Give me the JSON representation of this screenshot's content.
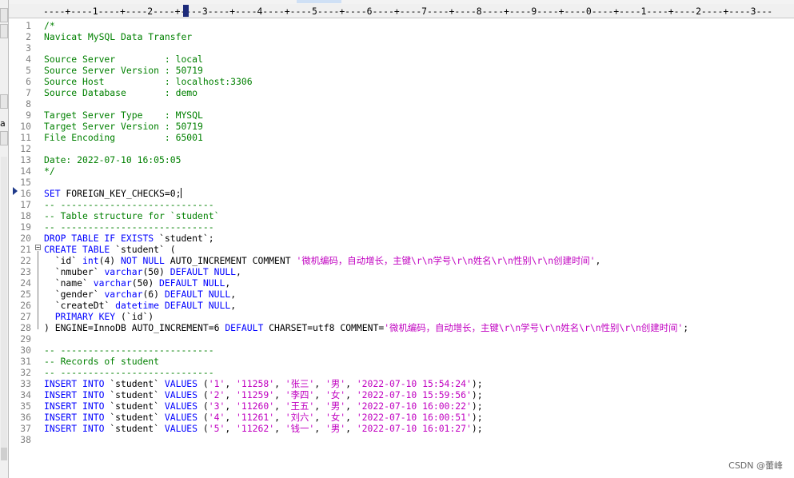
{
  "colors": {
    "keyword": "#0000ff",
    "comment": "#008000",
    "string": "#c000c0",
    "text": "#000000",
    "line_number": "#808080"
  },
  "ruler": {
    "text": "----+----1----+----2----+----3----+----4----+----5----+----6----+----7----+----8----+----9----+----0----+----1----+----2----+----3---"
  },
  "left_panel": {
    "sliver_text": "a"
  },
  "editor": {
    "caret_line": 16,
    "lines": [
      {
        "n": "1",
        "tokens": [
          {
            "t": "/*",
            "c": "comment"
          }
        ]
      },
      {
        "n": "2",
        "tokens": [
          {
            "t": "Navicat MySQL Data Transfer",
            "c": "comment"
          }
        ]
      },
      {
        "n": "3",
        "tokens": []
      },
      {
        "n": "4",
        "tokens": [
          {
            "t": "Source Server         : local",
            "c": "comment"
          }
        ]
      },
      {
        "n": "5",
        "tokens": [
          {
            "t": "Source Server Version : 50719",
            "c": "comment"
          }
        ]
      },
      {
        "n": "6",
        "tokens": [
          {
            "t": "Source Host           : localhost:3306",
            "c": "comment"
          }
        ]
      },
      {
        "n": "7",
        "tokens": [
          {
            "t": "Source Database       : demo",
            "c": "comment"
          }
        ]
      },
      {
        "n": "8",
        "tokens": []
      },
      {
        "n": "9",
        "tokens": [
          {
            "t": "Target Server Type    : MYSQL",
            "c": "comment"
          }
        ]
      },
      {
        "n": "10",
        "tokens": [
          {
            "t": "Target Server Version : 50719",
            "c": "comment"
          }
        ]
      },
      {
        "n": "11",
        "tokens": [
          {
            "t": "File Encoding         : 65001",
            "c": "comment"
          }
        ]
      },
      {
        "n": "12",
        "tokens": []
      },
      {
        "n": "13",
        "tokens": [
          {
            "t": "Date: 2022-07-10 16:05:05",
            "c": "comment"
          }
        ]
      },
      {
        "n": "14",
        "tokens": [
          {
            "t": "*/",
            "c": "comment"
          }
        ]
      },
      {
        "n": "15",
        "tokens": []
      },
      {
        "n": "16",
        "tokens": [
          {
            "t": "SET",
            "c": "keyword"
          },
          {
            "t": " FOREIGN_KEY_CHECKS=0;",
            "c": "text"
          }
        ]
      },
      {
        "n": "17",
        "tokens": [
          {
            "t": "-- ----------------------------",
            "c": "comment"
          }
        ]
      },
      {
        "n": "18",
        "tokens": [
          {
            "t": "-- Table structure for `student`",
            "c": "comment"
          }
        ]
      },
      {
        "n": "19",
        "tokens": [
          {
            "t": "-- ----------------------------",
            "c": "comment"
          }
        ]
      },
      {
        "n": "20",
        "tokens": [
          {
            "t": "DROP TABLE IF EXISTS",
            "c": "keyword"
          },
          {
            "t": " `student`;",
            "c": "text"
          }
        ]
      },
      {
        "n": "21",
        "tokens": [
          {
            "t": "CREATE TABLE",
            "c": "keyword"
          },
          {
            "t": " `student` (",
            "c": "text"
          }
        ]
      },
      {
        "n": "22",
        "tokens": [
          {
            "t": "  `id` ",
            "c": "text"
          },
          {
            "t": "int",
            "c": "keyword"
          },
          {
            "t": "(4) ",
            "c": "text"
          },
          {
            "t": "NOT NULL",
            "c": "keyword"
          },
          {
            "t": " AUTO_INCREMENT COMMENT ",
            "c": "text"
          },
          {
            "t": "'微机编码，自动增长，主键\\r\\n学号\\r\\n姓名\\r\\n性别\\r\\n创建时间'",
            "c": "string"
          },
          {
            "t": ",",
            "c": "text"
          }
        ]
      },
      {
        "n": "23",
        "tokens": [
          {
            "t": "  `nmuber` ",
            "c": "text"
          },
          {
            "t": "varchar",
            "c": "keyword"
          },
          {
            "t": "(50) ",
            "c": "text"
          },
          {
            "t": "DEFAULT NULL",
            "c": "keyword"
          },
          {
            "t": ",",
            "c": "text"
          }
        ]
      },
      {
        "n": "24",
        "tokens": [
          {
            "t": "  `name` ",
            "c": "text"
          },
          {
            "t": "varchar",
            "c": "keyword"
          },
          {
            "t": "(50) ",
            "c": "text"
          },
          {
            "t": "DEFAULT NULL",
            "c": "keyword"
          },
          {
            "t": ",",
            "c": "text"
          }
        ]
      },
      {
        "n": "25",
        "tokens": [
          {
            "t": "  `gender` ",
            "c": "text"
          },
          {
            "t": "varchar",
            "c": "keyword"
          },
          {
            "t": "(6) ",
            "c": "text"
          },
          {
            "t": "DEFAULT NULL",
            "c": "keyword"
          },
          {
            "t": ",",
            "c": "text"
          }
        ]
      },
      {
        "n": "26",
        "tokens": [
          {
            "t": "  `createDt` ",
            "c": "text"
          },
          {
            "t": "datetime",
            "c": "keyword"
          },
          {
            "t": " ",
            "c": "text"
          },
          {
            "t": "DEFAULT NULL",
            "c": "keyword"
          },
          {
            "t": ",",
            "c": "text"
          }
        ]
      },
      {
        "n": "27",
        "tokens": [
          {
            "t": "  ",
            "c": "text"
          },
          {
            "t": "PRIMARY KEY",
            "c": "keyword"
          },
          {
            "t": " (`id`)",
            "c": "text"
          }
        ]
      },
      {
        "n": "28",
        "tokens": [
          {
            "t": ") ENGINE=InnoDB AUTO_INCREMENT=6 ",
            "c": "text"
          },
          {
            "t": "DEFAULT",
            "c": "keyword"
          },
          {
            "t": " CHARSET=utf8 COMMENT=",
            "c": "text"
          },
          {
            "t": "'微机编码，自动增长，主键\\r\\n学号\\r\\n姓名\\r\\n性别\\r\\n创建时间'",
            "c": "string"
          },
          {
            "t": ";",
            "c": "text"
          }
        ]
      },
      {
        "n": "29",
        "tokens": []
      },
      {
        "n": "30",
        "tokens": [
          {
            "t": "-- ----------------------------",
            "c": "comment"
          }
        ]
      },
      {
        "n": "31",
        "tokens": [
          {
            "t": "-- Records of student",
            "c": "comment"
          }
        ]
      },
      {
        "n": "32",
        "tokens": [
          {
            "t": "-- ----------------------------",
            "c": "comment"
          }
        ]
      },
      {
        "n": "33",
        "tokens": [
          {
            "t": "INSERT INTO",
            "c": "keyword"
          },
          {
            "t": " `student` ",
            "c": "text"
          },
          {
            "t": "VALUES",
            "c": "keyword"
          },
          {
            "t": " (",
            "c": "text"
          },
          {
            "t": "'1'",
            "c": "string"
          },
          {
            "t": ", ",
            "c": "text"
          },
          {
            "t": "'11258'",
            "c": "string"
          },
          {
            "t": ", ",
            "c": "text"
          },
          {
            "t": "'张三'",
            "c": "string"
          },
          {
            "t": ", ",
            "c": "text"
          },
          {
            "t": "'男'",
            "c": "string"
          },
          {
            "t": ", ",
            "c": "text"
          },
          {
            "t": "'2022-07-10 15:54:24'",
            "c": "string"
          },
          {
            "t": ");",
            "c": "text"
          }
        ]
      },
      {
        "n": "34",
        "tokens": [
          {
            "t": "INSERT INTO",
            "c": "keyword"
          },
          {
            "t": " `student` ",
            "c": "text"
          },
          {
            "t": "VALUES",
            "c": "keyword"
          },
          {
            "t": " (",
            "c": "text"
          },
          {
            "t": "'2'",
            "c": "string"
          },
          {
            "t": ", ",
            "c": "text"
          },
          {
            "t": "'11259'",
            "c": "string"
          },
          {
            "t": ", ",
            "c": "text"
          },
          {
            "t": "'李四'",
            "c": "string"
          },
          {
            "t": ", ",
            "c": "text"
          },
          {
            "t": "'女'",
            "c": "string"
          },
          {
            "t": ", ",
            "c": "text"
          },
          {
            "t": "'2022-07-10 15:59:56'",
            "c": "string"
          },
          {
            "t": ");",
            "c": "text"
          }
        ]
      },
      {
        "n": "35",
        "tokens": [
          {
            "t": "INSERT INTO",
            "c": "keyword"
          },
          {
            "t": " `student` ",
            "c": "text"
          },
          {
            "t": "VALUES",
            "c": "keyword"
          },
          {
            "t": " (",
            "c": "text"
          },
          {
            "t": "'3'",
            "c": "string"
          },
          {
            "t": ", ",
            "c": "text"
          },
          {
            "t": "'11260'",
            "c": "string"
          },
          {
            "t": ", ",
            "c": "text"
          },
          {
            "t": "'王五'",
            "c": "string"
          },
          {
            "t": ", ",
            "c": "text"
          },
          {
            "t": "'男'",
            "c": "string"
          },
          {
            "t": ", ",
            "c": "text"
          },
          {
            "t": "'2022-07-10 16:00:22'",
            "c": "string"
          },
          {
            "t": ");",
            "c": "text"
          }
        ]
      },
      {
        "n": "36",
        "tokens": [
          {
            "t": "INSERT INTO",
            "c": "keyword"
          },
          {
            "t": " `student` ",
            "c": "text"
          },
          {
            "t": "VALUES",
            "c": "keyword"
          },
          {
            "t": " (",
            "c": "text"
          },
          {
            "t": "'4'",
            "c": "string"
          },
          {
            "t": ", ",
            "c": "text"
          },
          {
            "t": "'11261'",
            "c": "string"
          },
          {
            "t": ", ",
            "c": "text"
          },
          {
            "t": "'刘六'",
            "c": "string"
          },
          {
            "t": ", ",
            "c": "text"
          },
          {
            "t": "'女'",
            "c": "string"
          },
          {
            "t": ", ",
            "c": "text"
          },
          {
            "t": "'2022-07-10 16:00:51'",
            "c": "string"
          },
          {
            "t": ");",
            "c": "text"
          }
        ]
      },
      {
        "n": "37",
        "tokens": [
          {
            "t": "INSERT INTO",
            "c": "keyword"
          },
          {
            "t": " `student` ",
            "c": "text"
          },
          {
            "t": "VALUES",
            "c": "keyword"
          },
          {
            "t": " (",
            "c": "text"
          },
          {
            "t": "'5'",
            "c": "string"
          },
          {
            "t": ", ",
            "c": "text"
          },
          {
            "t": "'11262'",
            "c": "string"
          },
          {
            "t": ", ",
            "c": "text"
          },
          {
            "t": "'钱一'",
            "c": "string"
          },
          {
            "t": ", ",
            "c": "text"
          },
          {
            "t": "'男'",
            "c": "string"
          },
          {
            "t": ", ",
            "c": "text"
          },
          {
            "t": "'2022-07-10 16:01:27'",
            "c": "string"
          },
          {
            "t": ");",
            "c": "text"
          }
        ]
      },
      {
        "n": "38",
        "tokens": []
      }
    ]
  },
  "watermark": "CSDN @蕾峰"
}
